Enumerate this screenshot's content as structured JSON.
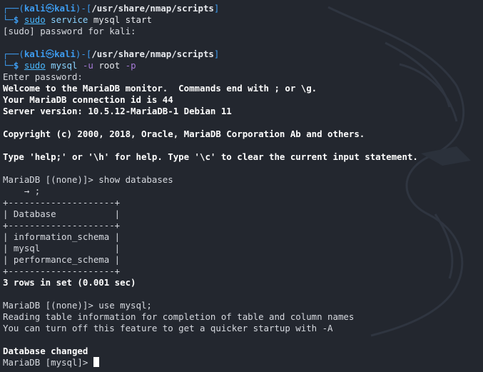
{
  "prompt": {
    "user": "kali",
    "host": "kali",
    "path": "/usr/share/nmap/scripts",
    "dollar": "$"
  },
  "block1": {
    "cmd_sudo": "sudo",
    "cmd_service": "service",
    "cmd_rest": " mysql start",
    "out1": "[sudo] password for kali:"
  },
  "block2": {
    "cmd_sudo": "sudo",
    "cmd_mysql": " mysql",
    "cmd_u": " -u",
    "cmd_root": " root",
    "cmd_p": " -p",
    "out_enter": "Enter password:",
    "welcome": "Welcome to the MariaDB monitor.  Commands end with ; or \\g.",
    "conn": "Your MariaDB connection id is 44",
    "version": "Server version: 10.5.12-MariaDB-1 Debian 11",
    "copyright": "Copyright (c) 2000, 2018, Oracle, MariaDB Corporation Ab and others.",
    "help": "Type 'help;' or '\\h' for help. Type '\\c' to clear the current input statement."
  },
  "query1": {
    "prompt": "MariaDB [(none)]> show databases",
    "cont": "    → ;",
    "border": "+--------------------+",
    "header": "| Database           |",
    "rows": [
      "| information_schema |",
      "| mysql              |",
      "| performance_schema |"
    ],
    "summary": "3 rows in set (0.001 sec)"
  },
  "query2": {
    "prompt": "MariaDB [(none)]> use mysql;",
    "out1": "Reading table information for completion of table and column names",
    "out2": "You can turn off this feature to get a quicker startup with -A",
    "changed": "Database changed",
    "final_prompt": "MariaDB [mysql]> "
  }
}
